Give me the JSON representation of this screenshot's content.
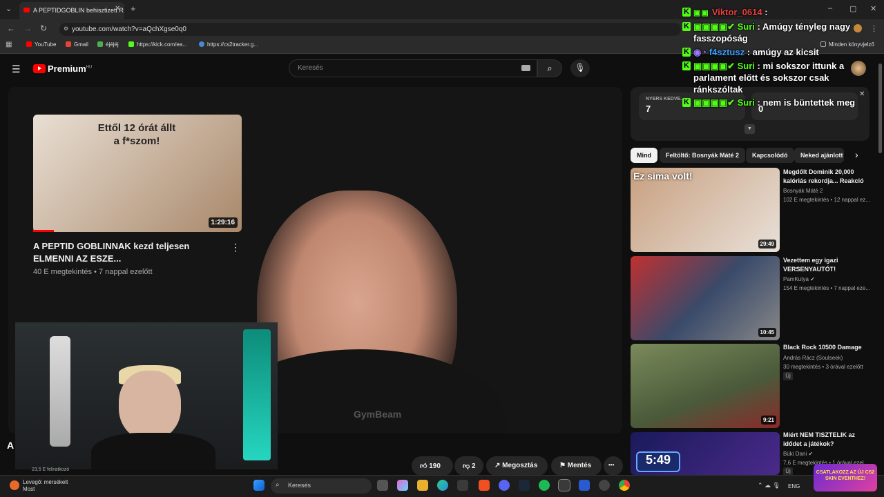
{
  "browser": {
    "tab_title": "A PEPTIDGOBLIN behisztizett R...",
    "url": "youtube.com/watch?v=aQchXgse0q0",
    "bookmarks": [
      "YouTube",
      "Gmail",
      "éjéjéj",
      "https://kick.com/ea...",
      "https://cs2tracker.g..."
    ],
    "all_bookmarks": "Minden könyvjelző"
  },
  "yt": {
    "logo": "Premium",
    "logo_region": "HU",
    "search_placeholder": "Keresés"
  },
  "video": {
    "brand_text": "GymBeam",
    "endcard": {
      "thumb_text": "Ettől 12 órát állt a f*szom!",
      "duration": "1:29:16",
      "title": "A PEPTID GOBLINNAK kezd teljesen ELMENNI AZ ESZE...",
      "meta": "40 E megtekintés • 7 nappal ezelőtt"
    },
    "corner_letter": "A",
    "tiny_text": "23,5 E feliratkozó"
  },
  "actions": {
    "likes": "190",
    "dislikes": "2",
    "share": "Megosztás",
    "save": "Mentés",
    "more": "•••"
  },
  "chat_summary": {
    "card1_label": "NYERS KEDVE...",
    "card1_value": "7",
    "card2_value": "0"
  },
  "chips": [
    "Mind",
    "Feltöltő: Bosnyák Máté 2",
    "Kapcsolódó",
    "Neked ajánlott"
  ],
  "recommendations": [
    {
      "thumb_text": "Ez sima volt!",
      "duration": "29:49",
      "title": "Megdőlt Dominik 20,000 kalóriás rekordja... Reakció",
      "channel": "Bosnyák Máté 2",
      "meta": "102 E megtekintés • 12 nappal ez...",
      "thumb_color": "#b08a6a"
    },
    {
      "thumb_text": "",
      "duration": "10:45",
      "title": "Vezettem egy igazi VERSENYAUTÓT!",
      "channel": "PamKutya",
      "meta": "154 E megtekintés • 7 nappal eze...",
      "thumb_color": "#3a4a6a"
    },
    {
      "thumb_text": "",
      "duration": "9:21",
      "title": "Black Rock 10500 Damage",
      "channel": "András Rácz (Soulseek)",
      "meta": "30 megtekintés • 3 órával ezelőtt",
      "badge": "Új",
      "thumb_color": "#5a6a4a"
    },
    {
      "thumb_text": "5:49",
      "duration": "",
      "title": "Miért NEM TISZTELIK az idődet a játékok?",
      "channel": "Büki Dani",
      "meta": "7,6 E megtekintés • 1 órával ezel...",
      "badge": "Új",
      "thumb_color": "#2a2a6a"
    }
  ],
  "chat_overlay": [
    {
      "user": "Viktor_0614",
      "text": " :",
      "user_color": "#e84040"
    },
    {
      "user": "Suri",
      "text": " : Amúgy tényleg nagy fasszopóság",
      "user_color": "#53fc18"
    },
    {
      "user": "f4sztusz",
      "text": " : amúgy az kicsit",
      "user_color": "#3aa0ff"
    },
    {
      "user": "Suri",
      "text": " : mi sokszor ittunk a parlament előtt és sokszor csak ránkszóltak",
      "user_color": "#53fc18"
    },
    {
      "user": "Suri",
      "text": " : nem is büntettek meg",
      "user_color": "#53fc18"
    }
  ],
  "taskbar": {
    "weather_line1": "Levegő: mérsékelt",
    "weather_line2": "Most",
    "search": "Keresés",
    "lang": "ENG",
    "promo": "CSATLAKOZZ AZ ÚJ CS2 SKIN EVENTHEZ!"
  }
}
